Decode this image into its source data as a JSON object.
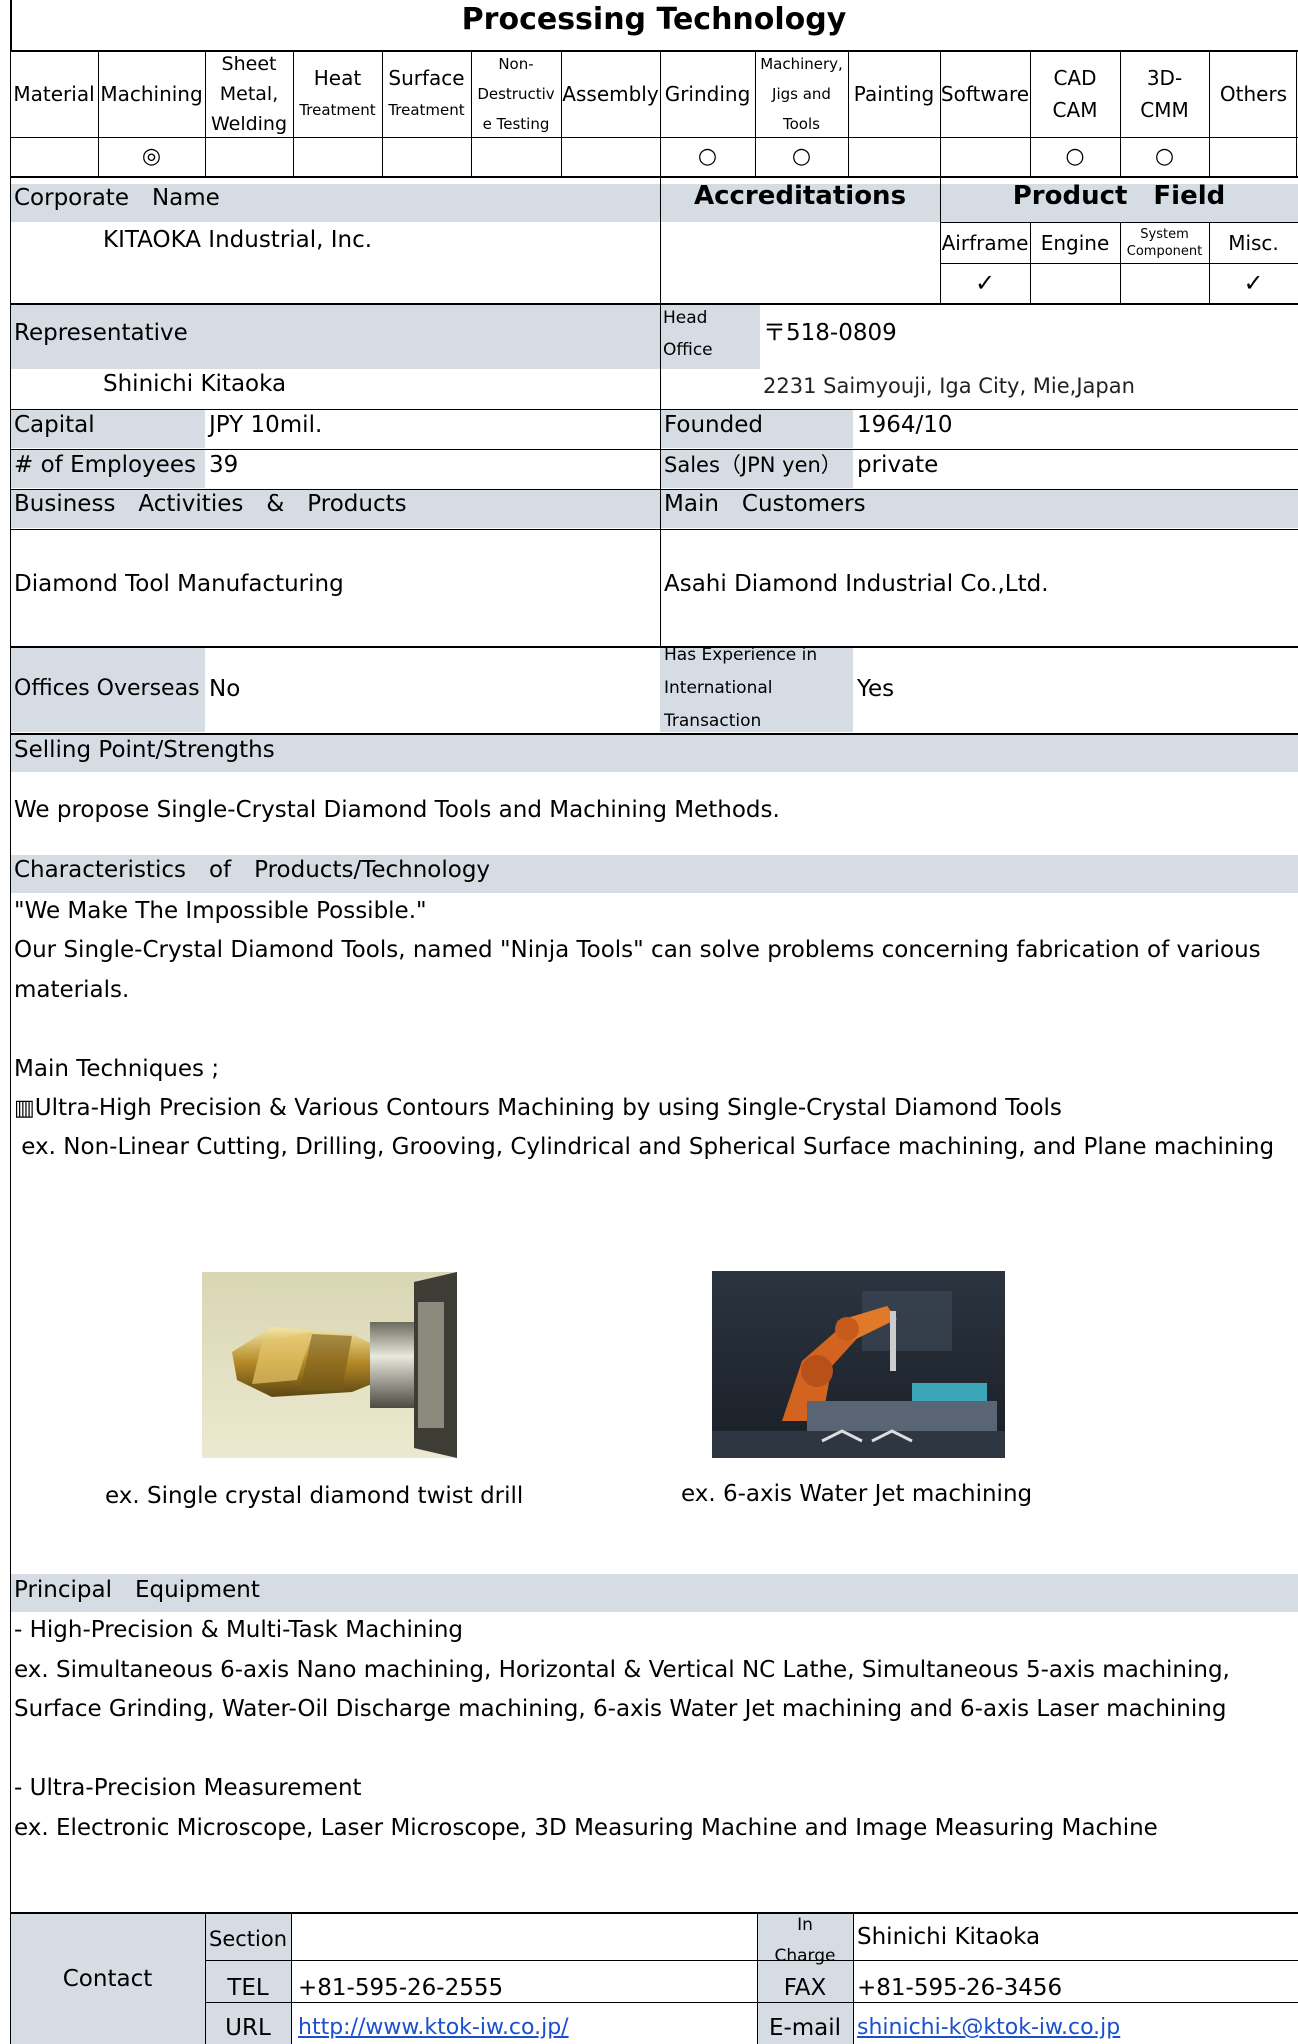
{
  "processing": {
    "title": "Processing Technology",
    "columns": [
      {
        "label": [
          "Material"
        ],
        "mark": ""
      },
      {
        "label": [
          "Machining"
        ],
        "mark": "◎"
      },
      {
        "label": [
          "Sheet",
          "Metal,",
          "Welding"
        ],
        "mark": ""
      },
      {
        "label": [
          "Heat",
          "Treatment"
        ],
        "mark": ""
      },
      {
        "label": [
          "Surface",
          "Treatment"
        ],
        "mark": ""
      },
      {
        "label": [
          "Non-",
          "Destructiv",
          "e Testing"
        ],
        "mark": ""
      },
      {
        "label": [
          "Assembly"
        ],
        "mark": ""
      },
      {
        "label": [
          "Grinding"
        ],
        "mark": "○"
      },
      {
        "label": [
          "Machinery,",
          "Jigs and",
          "Tools"
        ],
        "mark": "○"
      },
      {
        "label": [
          "Painting"
        ],
        "mark": ""
      },
      {
        "label": [
          "Software"
        ],
        "mark": ""
      },
      {
        "label": [
          "CAD",
          "CAM"
        ],
        "mark": "○"
      },
      {
        "label": [
          "3D-",
          "CMM"
        ],
        "mark": "○"
      },
      {
        "label": [
          "Others"
        ],
        "mark": ""
      }
    ]
  },
  "corporate": {
    "label": "Corporate　Name",
    "value": "KITAOKA Industrial, Inc."
  },
  "accreditations": {
    "label": "Accreditations",
    "value": ""
  },
  "product_field": {
    "label": "Product　Field",
    "items": [
      {
        "label": "Airframe",
        "mark": "✓"
      },
      {
        "label": "Engine",
        "mark": ""
      },
      {
        "label": "System Component",
        "mark": ""
      },
      {
        "label": "Misc.",
        "mark": "✓"
      }
    ]
  },
  "representative": {
    "label": "Representative",
    "value": "Shinichi Kitaoka"
  },
  "head_office": {
    "label_1": "Head",
    "label_2": "Office",
    "postal": "〒518-0809",
    "address": "2231 Saimyouji, Iga City, Mie,Japan"
  },
  "capital": {
    "label": "Capital",
    "value": "JPY 10mil."
  },
  "founded": {
    "label": "Founded",
    "value": "1964/10"
  },
  "employees": {
    "label": "# of Employees",
    "value": "39"
  },
  "sales": {
    "label": "Sales（JPN yen）",
    "value": "private"
  },
  "business": {
    "label": "Business　Activities　&　Products",
    "value": "Diamond Tool Manufacturing"
  },
  "customers": {
    "label": "Main　Customers",
    "value": "Asahi Diamond Industrial Co.,Ltd."
  },
  "overseas": {
    "label": "Offices Overseas",
    "value": "No"
  },
  "international": {
    "label_lines": [
      "Has Experience in",
      "International",
      "Transaction"
    ],
    "value": "Yes"
  },
  "selling": {
    "label": "Selling Point/Strengths",
    "value": "We propose Single-Crystal Diamond Tools and Machining Methods."
  },
  "characteristics": {
    "label": "Characteristics　of　Products/Technology",
    "lines": [
      "\"We Make The Impossible Possible.\"",
      "Our Single-Crystal Diamond Tools, named \"Ninja Tools\" can solve problems concerning fabrication of various",
      "materials.",
      "",
      "Main Techniques ;",
      "Ultra-High Precision & Various Contours Machining by using Single-Crystal Diamond Tools",
      " ex. Non-Linear Cutting, Drilling, Grooving, Cylindrical and Spherical Surface machining, and Plane machining"
    ],
    "bullet_glyph": "▥",
    "captions": [
      "ex. Single crystal diamond twist drill",
      "ex. 6-axis Water Jet machining"
    ]
  },
  "equipment": {
    "label": "Principal　Equipment",
    "lines": [
      "- High-Precision & Multi-Task Machining",
      "ex. Simultaneous 6-axis Nano machining, Horizontal & Vertical NC Lathe, Simultaneous 5-axis machining,",
      "Surface Grinding, Water-Oil Discharge machining, 6-axis Water Jet machining and 6-axis Laser machining",
      "",
      "- Ultra-Precision Measurement",
      "ex. Electronic Microscope, Laser Microscope, 3D Measuring Machine and Image Measuring Machine"
    ]
  },
  "contact": {
    "label": "Contact",
    "section_label": "Section",
    "section_value": "",
    "incharge_label_1": "In",
    "incharge_label_2": "Charge",
    "incharge_value": "Shinichi Kitaoka",
    "tel_label": "TEL",
    "tel_value": "+81-595-26-2555",
    "fax_label": "FAX",
    "fax_value": "+81-595-26-3456",
    "url_label": "URL",
    "url_value": "http://www.ktok-iw.co.jp/",
    "email_label": "E-mail",
    "email_value": "shinichi-k@ktok-iw.co.jp"
  },
  "colors": {
    "band": "#d6dce4",
    "link": "#1a4fd0"
  }
}
